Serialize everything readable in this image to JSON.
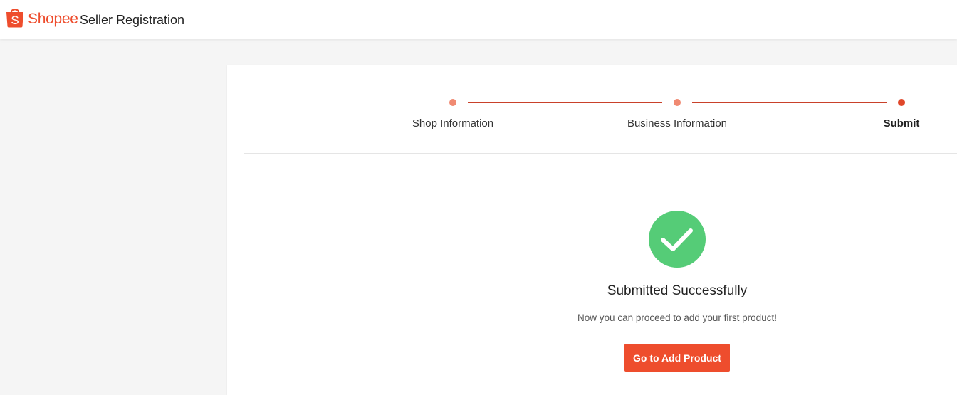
{
  "header": {
    "brand": "Shopee",
    "title": "Seller Registration",
    "logo_letter": "S"
  },
  "stepper": {
    "steps": [
      {
        "label": "Shop Information",
        "state": "completed"
      },
      {
        "label": "Business Information",
        "state": "completed"
      },
      {
        "label": "Submit",
        "state": "active"
      }
    ]
  },
  "result": {
    "icon": "checkmark-icon",
    "title": "Submitted Successfully",
    "message": "Now you can proceed to add your first product!",
    "button_label": "Go to Add Product"
  },
  "colors": {
    "brand": "#ee4d2d",
    "success": "#55cc77",
    "completed_dot": "#f08a72",
    "active_dot": "#e0472a"
  }
}
